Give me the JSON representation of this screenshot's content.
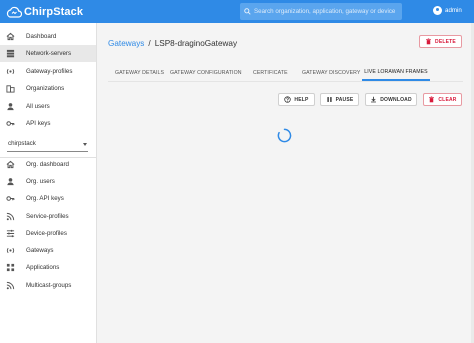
{
  "app": {
    "name": "ChirpStack"
  },
  "header": {
    "search_placeholder": "Search organization, application, gateway or device",
    "user_name": "admin"
  },
  "sidebar": {
    "global_items": [
      {
        "label": "Dashboard",
        "icon": "home-icon",
        "active": false
      },
      {
        "label": "Network-servers",
        "icon": "server-icon",
        "active": true
      },
      {
        "label": "Gateway-profiles",
        "icon": "radio-tower-icon",
        "active": false
      },
      {
        "label": "Organizations",
        "icon": "domain-icon",
        "active": false
      },
      {
        "label": "All users",
        "icon": "account-icon",
        "active": false
      },
      {
        "label": "API keys",
        "icon": "key-icon",
        "active": false
      }
    ],
    "organization_selected": "chirpstack",
    "org_items": [
      {
        "label": "Org. dashboard",
        "icon": "home-icon"
      },
      {
        "label": "Org. users",
        "icon": "account-icon"
      },
      {
        "label": "Org. API keys",
        "icon": "key-icon"
      },
      {
        "label": "Service-profiles",
        "icon": "rss-icon"
      },
      {
        "label": "Device-profiles",
        "icon": "tune-icon"
      },
      {
        "label": "Gateways",
        "icon": "radio-tower-icon"
      },
      {
        "label": "Applications",
        "icon": "apps-icon"
      },
      {
        "label": "Multicast-groups",
        "icon": "rss-icon"
      }
    ]
  },
  "breadcrumb": {
    "parent": "Gateways",
    "separator": "/",
    "current": "LSP8-draginoGateway"
  },
  "actions": {
    "delete": "DELETE"
  },
  "tabs": [
    {
      "label": "GATEWAY DETAILS",
      "active": false
    },
    {
      "label": "GATEWAY CONFIGURATION",
      "active": false
    },
    {
      "label": "CERTIFICATE",
      "active": false
    },
    {
      "label": "GATEWAY DISCOVERY",
      "active": false
    },
    {
      "label": "LIVE LORAWAN FRAMES",
      "active": true
    }
  ],
  "frame_controls": {
    "help": "HELP",
    "pause": "PAUSE",
    "download": "DOWNLOAD",
    "clear": "CLEAR"
  },
  "colors": {
    "primary": "#2f8ae6",
    "danger": "#d81b3c"
  }
}
